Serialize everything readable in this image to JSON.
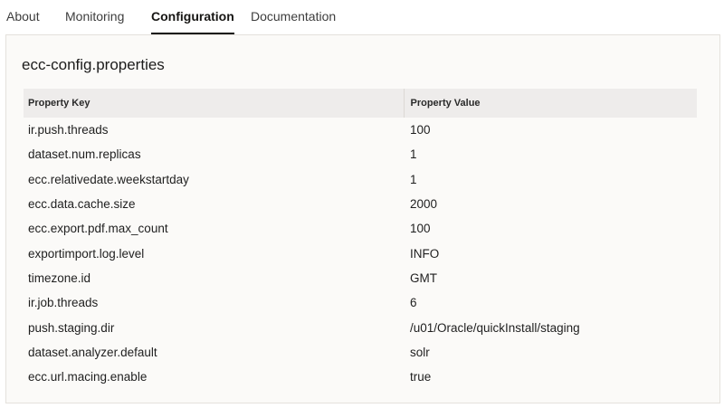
{
  "tabs": [
    {
      "label": "About",
      "active": false
    },
    {
      "label": "Monitoring",
      "active": false
    },
    {
      "label": "Configuration",
      "active": true
    },
    {
      "label": "Documentation",
      "active": false
    }
  ],
  "panel": {
    "title": "ecc-config.properties",
    "headers": {
      "key": "Property Key",
      "value": "Property Value"
    },
    "rows": [
      {
        "key": "ir.push.threads",
        "value": "100"
      },
      {
        "key": "dataset.num.replicas",
        "value": "1"
      },
      {
        "key": "ecc.relativedate.weekstartday",
        "value": "1"
      },
      {
        "key": "ecc.data.cache.size",
        "value": "2000"
      },
      {
        "key": "ecc.export.pdf.max_count",
        "value": "100"
      },
      {
        "key": "exportimport.log.level",
        "value": "INFO"
      },
      {
        "key": "timezone.id",
        "value": "GMT"
      },
      {
        "key": "ir.job.threads",
        "value": "6"
      },
      {
        "key": "push.staging.dir",
        "value": "/u01/Oracle/quickInstall/staging"
      },
      {
        "key": "dataset.analyzer.default",
        "value": "solr"
      },
      {
        "key": "ecc.url.macing.enable",
        "value": "true"
      }
    ]
  }
}
